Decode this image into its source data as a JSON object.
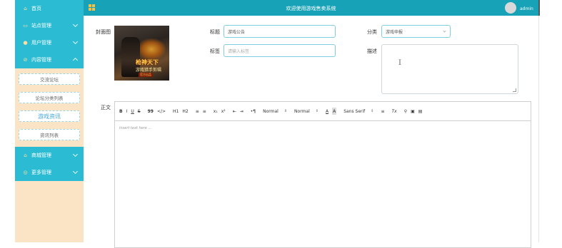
{
  "header": {
    "title": "欢迎使用游戏售卖系统",
    "username": "admin"
  },
  "sidebar": {
    "items": [
      {
        "label": "首页",
        "icon": "home-icon"
      },
      {
        "label": "站点管理",
        "icon": "site-icon"
      },
      {
        "label": "用户管理",
        "icon": "user-icon"
      },
      {
        "label": "内容管理",
        "icon": "content-icon"
      }
    ],
    "submenu": [
      {
        "label": "交流论坛"
      },
      {
        "label": "论坛分类列表"
      },
      {
        "label": "游戏资讯"
      },
      {
        "label": "资讯列表"
      }
    ],
    "items_after": [
      {
        "label": "商城管理",
        "icon": "shop-icon"
      },
      {
        "label": "更多管理",
        "icon": "more-icon"
      }
    ]
  },
  "form": {
    "cover_label": "封面图",
    "cover_image": {
      "title_line1": "枪神天下",
      "title_line2": "游戏猎手剪辑",
      "badge": "官方出品"
    },
    "title_label": "标题",
    "title_value": "游戏公告",
    "tags_label": "标签",
    "tags_placeholder": "请输入标签",
    "category_label": "分类",
    "category_value": "游戏申报",
    "description_label": "描述",
    "body_label": "正文",
    "editor_placeholder": "Insert text here ..."
  },
  "toolbar": {
    "bold": "B",
    "italic": "I",
    "underline": "U",
    "strike": "S",
    "quote": "99",
    "code": "</>",
    "h1": "H1",
    "h2": "H2",
    "ordered_list": "≡",
    "bullet_list": "≡",
    "subscript": "x₁",
    "superscript": "x²",
    "outdent": "⇤",
    "indent": "⇥",
    "direction": "•¶",
    "size_dropdown": "Normal",
    "header_dropdown": "Normal",
    "color": "A",
    "background": "A",
    "font_dropdown": "Sans Serif",
    "align": "≡",
    "clean": "Tx",
    "link": "⚲",
    "image": "▣",
    "video": "▤"
  },
  "colors": {
    "header_bg": "#17a2b8",
    "nav_bg": "#2bbcd4",
    "sidebar_bg": "#fbe3c6",
    "accent": "#3fa7e3"
  }
}
